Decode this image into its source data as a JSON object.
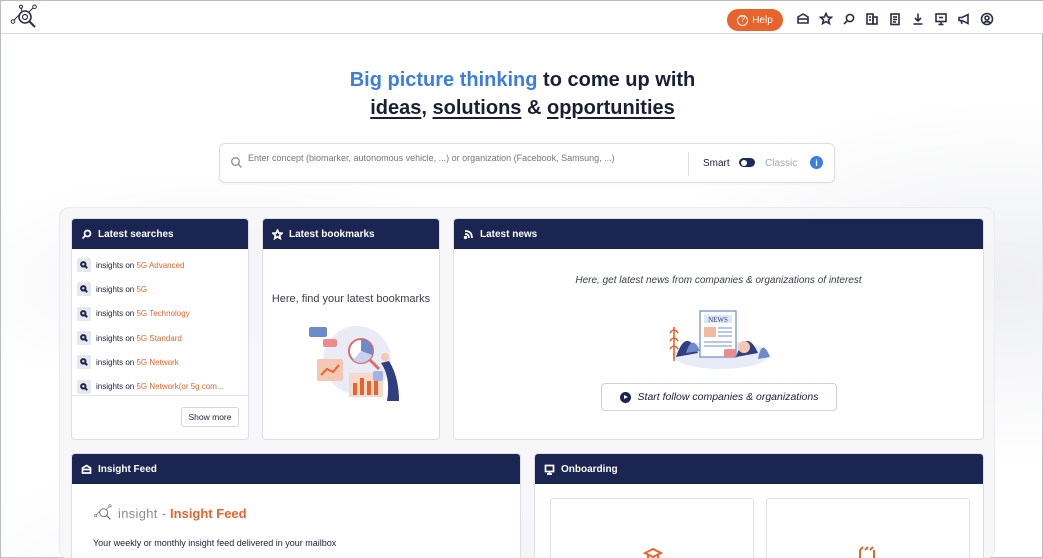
{
  "header": {
    "help_label": "Help",
    "icons": [
      "folder-open-icon",
      "star-icon",
      "search-icon",
      "building-icon",
      "clipboard-icon",
      "download-icon",
      "presentation-icon",
      "megaphone-icon",
      "user-circle-icon"
    ]
  },
  "hero": {
    "highlight": "Big picture thinking",
    "line1_rest": " to come up with",
    "ideas": "ideas",
    "comma": ", ",
    "solutions": "solutions",
    "amp": " & ",
    "opportunities": "opportunities"
  },
  "search": {
    "placeholder": "Enter concept (biomarker, autonomous vehicle, ...) or organization (Facebook, Samsung, ...)",
    "mode_smart": "Smart",
    "mode_classic": "Classic",
    "info": "i"
  },
  "latest_searches": {
    "title": "Latest searches",
    "prefix": "insights on ",
    "items": [
      "5G Advanced",
      "5G",
      "5G Technology",
      "5G Standard",
      "5G Network",
      "5G Network(or 5g com..."
    ],
    "show_more": "Show more"
  },
  "latest_bookmarks": {
    "title": "Latest bookmarks",
    "text": "Here, find your latest bookmarks"
  },
  "latest_news": {
    "title": "Latest news",
    "text": "Here, get latest news from companies & organizations of interest",
    "follow_button": "Start follow companies & organizations"
  },
  "insight_feed": {
    "title": "Insight Feed",
    "brand": "insight",
    "separator": "-",
    "feed_name": "Insight Feed",
    "description": "Your weekly or monthly insight feed delivered in your mailbox"
  },
  "onboarding": {
    "title": "Onboarding"
  },
  "colors": {
    "navy": "#1b2552",
    "accent_orange": "#e8642c",
    "accent_blue": "#3b7de0"
  }
}
